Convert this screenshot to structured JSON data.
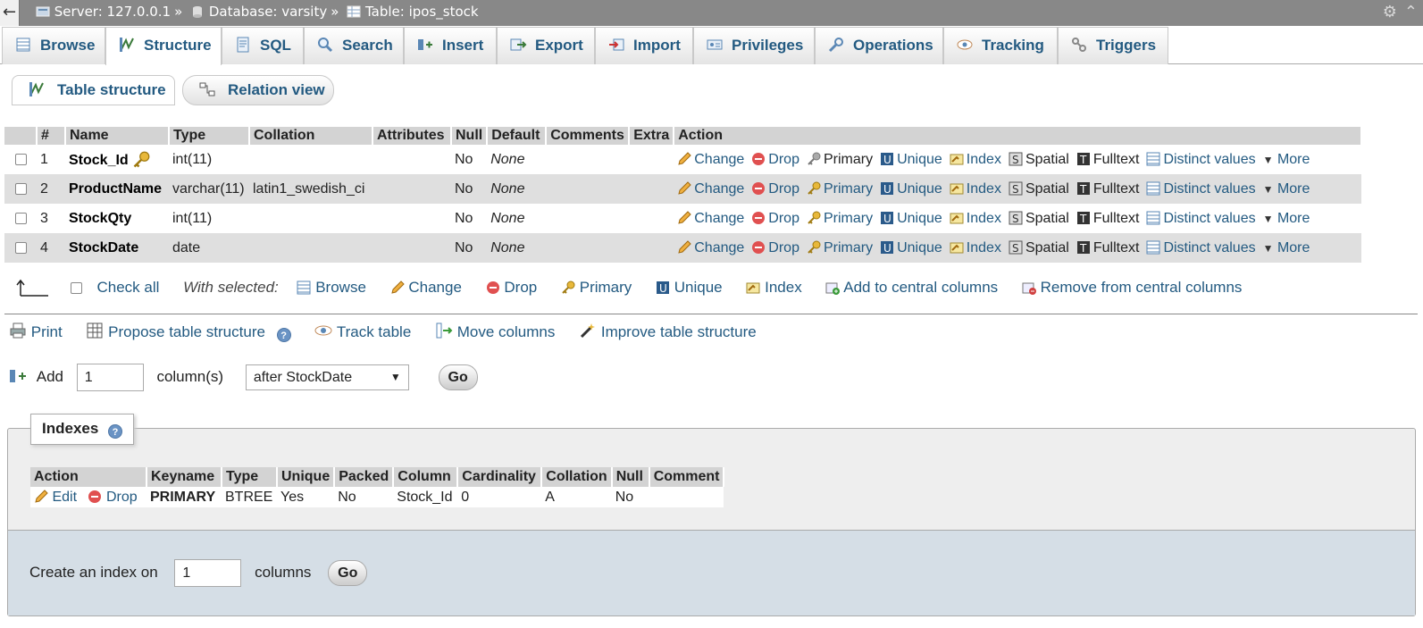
{
  "topbar": {
    "back": "←",
    "server_label": "Server: 127.0.0.1",
    "database_label": "Database: varsity",
    "table_label": "Table: ipos_stock",
    "separator": "»"
  },
  "tabs": [
    {
      "label": "Browse",
      "icon": "browse-icon"
    },
    {
      "label": "Structure",
      "icon": "structure-icon",
      "active": true
    },
    {
      "label": "SQL",
      "icon": "sql-icon"
    },
    {
      "label": "Search",
      "icon": "search-icon"
    },
    {
      "label": "Insert",
      "icon": "insert-icon"
    },
    {
      "label": "Export",
      "icon": "export-icon"
    },
    {
      "label": "Import",
      "icon": "import-icon"
    },
    {
      "label": "Privileges",
      "icon": "privileges-icon"
    },
    {
      "label": "Operations",
      "icon": "wrench-icon"
    },
    {
      "label": "Tracking",
      "icon": "eye-icon"
    },
    {
      "label": "Triggers",
      "icon": "triggers-icon"
    }
  ],
  "subtabs": {
    "table_structure": "Table structure",
    "relation_view": "Relation view"
  },
  "structure": {
    "headers": [
      "#",
      "Name",
      "Type",
      "Collation",
      "Attributes",
      "Null",
      "Default",
      "Comments",
      "Extra",
      "Action"
    ],
    "rows": [
      {
        "num": "1",
        "name": "Stock_Id",
        "type": "int(11)",
        "collation": "",
        "attributes": "",
        "null": "No",
        "default": "None",
        "comments": "",
        "extra": "",
        "primary_key": true
      },
      {
        "num": "2",
        "name": "ProductName",
        "type": "varchar(11)",
        "collation": "latin1_swedish_ci",
        "attributes": "",
        "null": "No",
        "default": "None",
        "comments": "",
        "extra": "",
        "primary_key": false
      },
      {
        "num": "3",
        "name": "StockQty",
        "type": "int(11)",
        "collation": "",
        "attributes": "",
        "null": "No",
        "default": "None",
        "comments": "",
        "extra": "",
        "primary_key": false
      },
      {
        "num": "4",
        "name": "StockDate",
        "type": "date",
        "collation": "",
        "attributes": "",
        "null": "No",
        "default": "None",
        "comments": "",
        "extra": "",
        "primary_key": false
      }
    ],
    "actions": {
      "change": "Change",
      "drop": "Drop",
      "primary": "Primary",
      "unique": "Unique",
      "index": "Index",
      "spatial": "Spatial",
      "fulltext": "Fulltext",
      "distinct": "Distinct values",
      "more": "More"
    }
  },
  "bulk": {
    "check_all": "Check all",
    "with_selected": "With selected:",
    "browse": "Browse",
    "change": "Change",
    "drop": "Drop",
    "primary": "Primary",
    "unique": "Unique",
    "index": "Index",
    "add_central": "Add to central columns",
    "remove_central": "Remove from central columns"
  },
  "tools": {
    "print": "Print",
    "propose": "Propose table structure",
    "track": "Track table",
    "move": "Move columns",
    "improve": "Improve table structure"
  },
  "add_columns": {
    "add_label": "Add",
    "count": "1",
    "columns_label": "column(s)",
    "position": "after StockDate",
    "go": "Go"
  },
  "indexes": {
    "legend": "Indexes",
    "headers": [
      "Action",
      "Keyname",
      "Type",
      "Unique",
      "Packed",
      "Column",
      "Cardinality",
      "Collation",
      "Null",
      "Comment"
    ],
    "rows": [
      {
        "edit": "Edit",
        "drop": "Drop",
        "keyname": "PRIMARY",
        "type": "BTREE",
        "unique": "Yes",
        "packed": "No",
        "column": "Stock_Id",
        "cardinality": "0",
        "collation": "A",
        "null": "No",
        "comment": ""
      }
    ],
    "create_label": "Create an index on",
    "create_count": "1",
    "create_columns_label": "columns",
    "go": "Go"
  },
  "colors": {
    "link": "#235a81",
    "topbar": "#888888",
    "row_even": "#dfdfdf",
    "header": "#d3d3d3"
  }
}
